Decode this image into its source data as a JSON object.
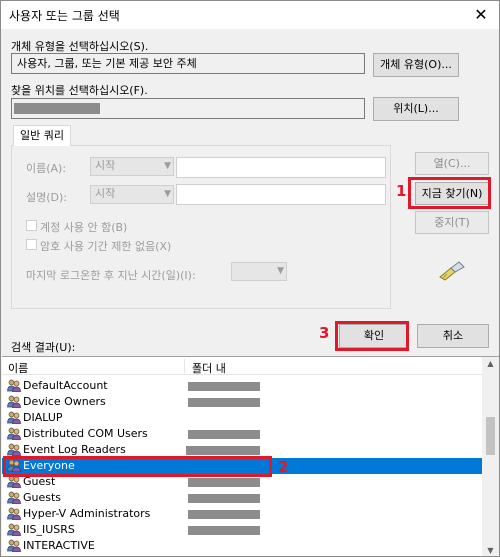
{
  "window": {
    "title": "사용자 또는 그룹 선택"
  },
  "object_type": {
    "label": "개체 유형을 선택하십시오(S).",
    "value": "사용자, 그룹, 또는 기본 제공 보안 주체",
    "button": "개체 유형(O)..."
  },
  "location": {
    "label": "찾을 위치를 선택하십시오(F).",
    "button": "위치(L)..."
  },
  "tab": {
    "label": "일반 쿼리"
  },
  "query": {
    "name_label": "이름(A):",
    "name_mode": "시작",
    "desc_label": "설명(D):",
    "desc_mode": "시작",
    "disabled_accounts": "계정 사용 안 함(B)",
    "no_expire_password": "암호 사용 기간 제한 없음(X)",
    "days_since_login": "마지막 로그온한 후 지난 시간(일)(I):"
  },
  "side_buttons": {
    "columns": "열(C)...",
    "find_now": "지금 찾기(N)",
    "stop": "중지(T)"
  },
  "ok_label": "확인",
  "cancel_label": "취소",
  "annotations": {
    "n1": "1",
    "n2": "2",
    "n3": "3"
  },
  "results": {
    "label": "검색 결과(U):",
    "col_name": "이름",
    "col_folder": "폴더 내",
    "rows": [
      {
        "name": "DefaultAccount"
      },
      {
        "name": "Device Owners"
      },
      {
        "name": "DIALUP"
      },
      {
        "name": "Distributed COM Users"
      },
      {
        "name": "Event Log Readers"
      },
      {
        "name": "Everyone",
        "selected": true
      },
      {
        "name": "Guest"
      },
      {
        "name": "Guests"
      },
      {
        "name": "Hyper-V Administrators"
      },
      {
        "name": "IIS_IUSRS"
      },
      {
        "name": "INTERACTIVE"
      }
    ]
  },
  "colors": {
    "accent": "#0078d7",
    "annotation": "#e0192a",
    "redacted": "#8c8c8c"
  }
}
